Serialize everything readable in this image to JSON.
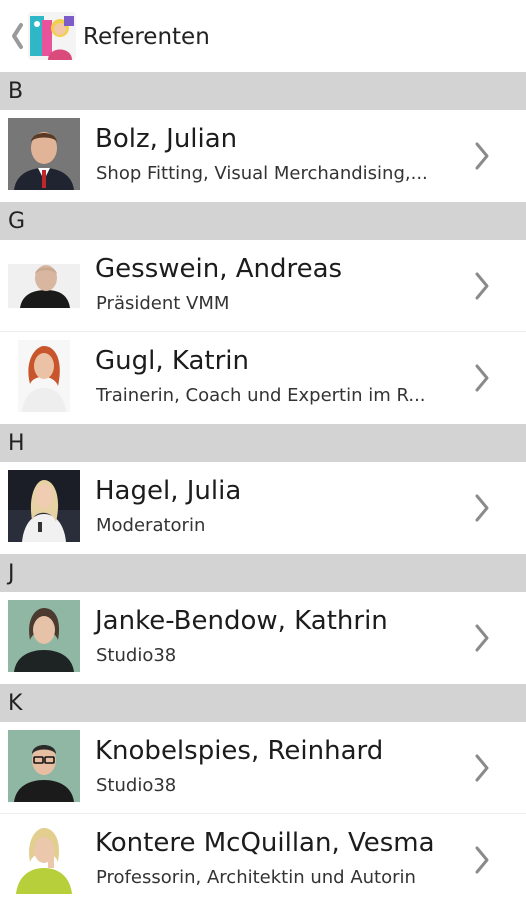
{
  "header": {
    "title": "Referenten"
  },
  "sections": [
    {
      "letter": "B",
      "items": [
        {
          "name": "Bolz, Julian",
          "subtitle": "Shop Fitting, Visual Merchandising,..."
        }
      ]
    },
    {
      "letter": "G",
      "items": [
        {
          "name": "Gesswein, Andreas",
          "subtitle": "Präsident VMM"
        },
        {
          "name": "Gugl, Katrin",
          "subtitle": "Trainerin, Coach und Expertin im R..."
        }
      ]
    },
    {
      "letter": "H",
      "items": [
        {
          "name": "Hagel, Julia",
          "subtitle": "Moderatorin"
        }
      ]
    },
    {
      "letter": "J",
      "items": [
        {
          "name": "Janke-Bendow, Kathrin",
          "subtitle": "Studio38"
        }
      ]
    },
    {
      "letter": "K",
      "items": [
        {
          "name": "Knobelspies, Reinhard",
          "subtitle": "Studio38"
        },
        {
          "name": "Kontere McQuillan, Vesma",
          "subtitle": "Professorin, Architektin und Autorin"
        }
      ]
    }
  ],
  "colors": {
    "section_bg": "#d3d3d3",
    "chevron": "#8a8a8a"
  },
  "icons": {
    "back": "chevron-left-icon",
    "row": "chevron-right-icon"
  }
}
